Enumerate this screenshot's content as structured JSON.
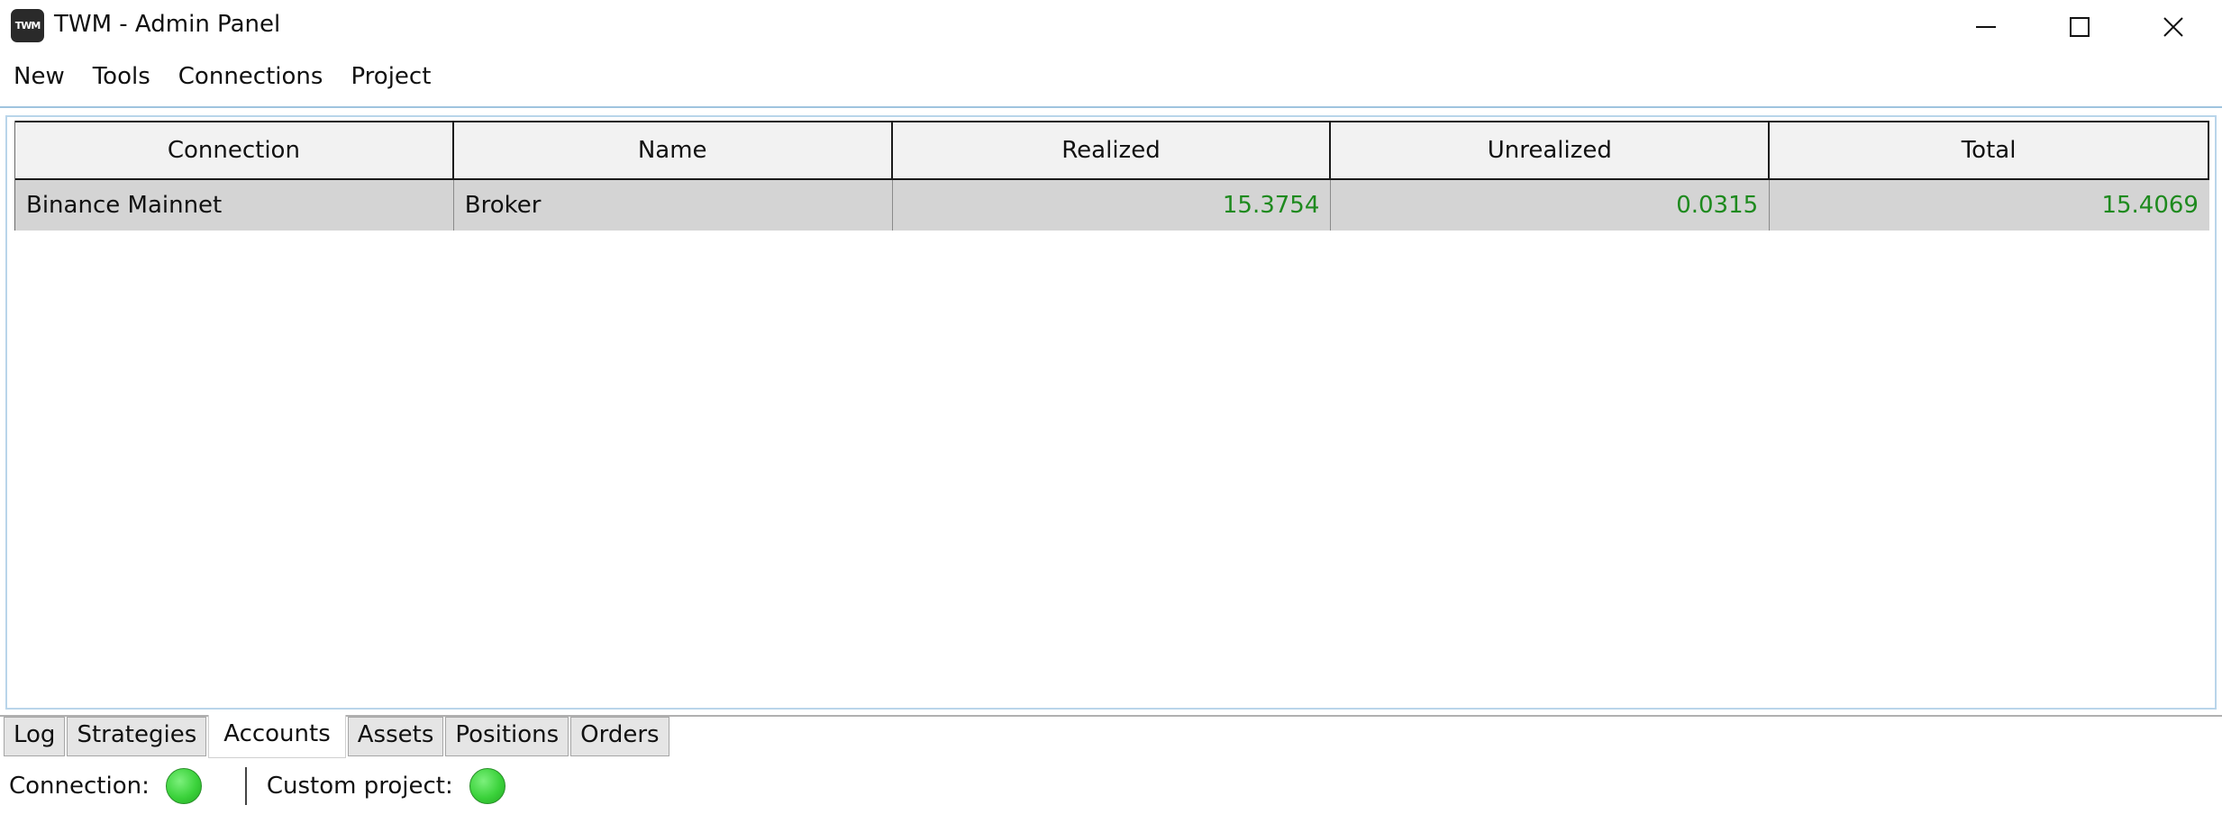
{
  "window": {
    "title": "TWM - Admin Panel",
    "icon_text": "TWM"
  },
  "menu": {
    "items": [
      {
        "label": "New"
      },
      {
        "label": "Tools"
      },
      {
        "label": "Connections"
      },
      {
        "label": "Project"
      }
    ]
  },
  "grid": {
    "columns": [
      "Connection",
      "Name",
      "Realized",
      "Unrealized",
      "Total"
    ],
    "rows": [
      {
        "connection": "Binance Mainnet",
        "name": "Broker",
        "realized": "15.3754",
        "unrealized": "0.0315",
        "total": "15.4069"
      }
    ],
    "positive_color": "#1e8a1e",
    "selected_row_color": "#d4d4d4"
  },
  "tabs": [
    {
      "label": "Log",
      "active": false
    },
    {
      "label": "Strategies",
      "active": false
    },
    {
      "label": "Accounts",
      "active": true
    },
    {
      "label": "Assets",
      "active": false
    },
    {
      "label": "Positions",
      "active": false
    },
    {
      "label": "Orders",
      "active": false
    }
  ],
  "status": {
    "connection_label": "Connection:",
    "connection_state": "green",
    "project_label": "Custom project:",
    "project_state": "green"
  }
}
